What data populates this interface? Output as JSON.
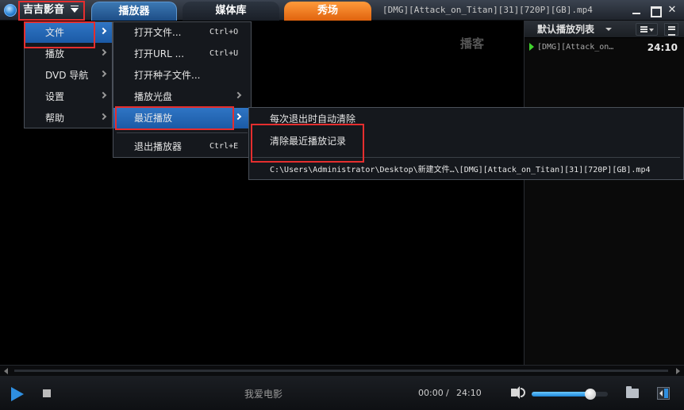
{
  "app": {
    "menu_button_label": "吉吉影音",
    "window_title": "[DMG][Attack_on_Titan][31][720P][GB].mp4"
  },
  "tabs": [
    {
      "label": "播放器",
      "active": true
    },
    {
      "label": "媒体库",
      "active": false
    },
    {
      "label": "秀场",
      "active": false
    }
  ],
  "video": {
    "watermark": "播客"
  },
  "main_menu": {
    "items": [
      {
        "label": "文件",
        "has_submenu": true,
        "active": true
      },
      {
        "label": "播放",
        "has_submenu": true
      },
      {
        "label": "DVD 导航",
        "has_submenu": true
      },
      {
        "label": "设置",
        "has_submenu": true
      },
      {
        "label": "帮助",
        "has_submenu": true
      }
    ]
  },
  "file_menu": {
    "items": [
      {
        "label": "打开文件...",
        "shortcut": "Ctrl+O"
      },
      {
        "label": "打开URL ...",
        "shortcut": "Ctrl+U"
      },
      {
        "label": "打开种子文件..."
      },
      {
        "label": "播放光盘",
        "has_submenu": true
      },
      {
        "label": "最近播放",
        "has_submenu": true,
        "active": true
      },
      {
        "label": "退出播放器",
        "shortcut": "Ctrl+E"
      }
    ]
  },
  "recent_menu": {
    "items": [
      {
        "label": "每次退出时自动清除"
      },
      {
        "label": "清除最近播放记录"
      },
      {
        "label": "C:\\Users\\Administrator\\Desktop\\新建文件…\\[DMG][Attack_on_Titan][31][720P][GB].mp4"
      }
    ]
  },
  "playlist": {
    "title": "默认播放列表",
    "items": [
      {
        "name": "[DMG][Attack_on…",
        "duration": "24:10",
        "playing": true
      }
    ]
  },
  "controls": {
    "subtitle_text": "我爱电影",
    "time_current": "00:00",
    "time_separator": "/",
    "time_total": "24:10",
    "volume_fraction": 0.77
  },
  "colors": {
    "accent": "#2f75c4",
    "highlight_box": "#e52e2e",
    "show_tab": "#ff9a3b",
    "playing_indicator": "#40d22e"
  }
}
